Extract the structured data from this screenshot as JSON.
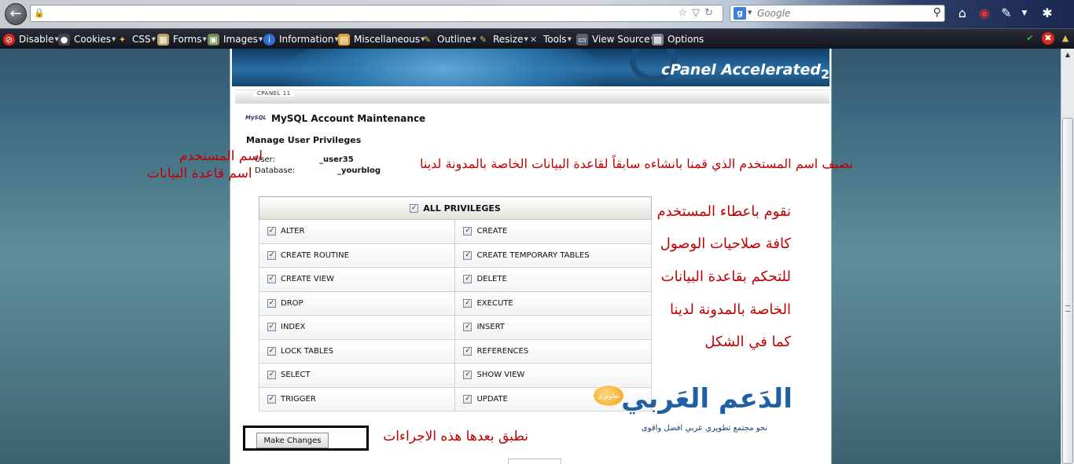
{
  "browser": {
    "search_placeholder": "Google",
    "search_engine_icon": "google-icon",
    "nav_icons": [
      "home-icon",
      "extension-icon",
      "pencil-icon",
      "menu-caret-icon",
      "wrench-icon"
    ]
  },
  "devbar": {
    "items": [
      {
        "label": "Disable",
        "icon": "disable-icon",
        "color": "#d62b1f"
      },
      {
        "label": "Cookies",
        "icon": "cookies-icon",
        "color": "#444444"
      },
      {
        "label": "CSS",
        "icon": "css-icon",
        "color": "#d9a400"
      },
      {
        "label": "Forms",
        "icon": "forms-icon",
        "color": "#b7a26a"
      },
      {
        "label": "Images",
        "icon": "images-icon",
        "color": "#6b8e4e"
      },
      {
        "label": "Information",
        "icon": "info-icon",
        "color": "#2f6fd6"
      },
      {
        "label": "Miscellaneous",
        "icon": "misc-icon",
        "color": "#d8a23a"
      },
      {
        "label": "Outline",
        "icon": "outline-icon",
        "color": "#e8c255"
      },
      {
        "label": "Resize",
        "icon": "resize-icon",
        "color": "#e8c255"
      },
      {
        "label": "Tools",
        "icon": "tools-icon",
        "color": "#9aa3ad"
      },
      {
        "label": "View Source",
        "icon": "view-source-icon",
        "color": "#5a6470"
      },
      {
        "label": "Options",
        "icon": "options-icon",
        "color": "#7a8490"
      }
    ],
    "status_icons": [
      "check-icon",
      "error-icon",
      "warning-icon"
    ]
  },
  "banner": {
    "logo_text": "cPanel Accelerated",
    "logo_suffix": "2",
    "version": "CPANEL 11"
  },
  "page": {
    "icon_label": "MySQL",
    "title": "MySQL Account Maintenance",
    "section": "Manage User Privileges",
    "user_label": "User:",
    "user_value": "_user35",
    "database_label": "Database:",
    "database_value": "_yourblog"
  },
  "privileges": {
    "header": "ALL PRIVILEGES",
    "rows": [
      [
        "ALTER",
        "CREATE"
      ],
      [
        "CREATE ROUTINE",
        "CREATE TEMPORARY TABLES"
      ],
      [
        "CREATE VIEW",
        "DELETE"
      ],
      [
        "DROP",
        "EXECUTE"
      ],
      [
        "INDEX",
        "INSERT"
      ],
      [
        "LOCK TABLES",
        "REFERENCES"
      ],
      [
        "SELECT",
        "SHOW VIEW"
      ],
      [
        "TRIGGER",
        "UPDATE"
      ]
    ]
  },
  "submit": {
    "label": "Make Changes"
  },
  "annotations": {
    "user_name": "اسم المستخدم",
    "db_name": "اسم قاعدة البيانات",
    "add_user": "نضيف اسم المستخدم الذي قمنا بانشاءه سابقاً لقاعدة البيانات الخاصة بالمدونة لدينا",
    "priv_lines": [
      "نقوم باعطاء المستخدم",
      "كافة صلاحيات الوصول",
      "للتحكم بقاعدة البيانات",
      "الخاصة بالمدونة لدينا",
      "كما في الشكل"
    ],
    "apply": "نطبق بعدها هذه الاجراءات"
  },
  "watermark": {
    "title": "الدَعم العَربي",
    "subtitle": "نحو مجتمع تطويري عربي افضل واقوى",
    "badge": "تطويري"
  }
}
